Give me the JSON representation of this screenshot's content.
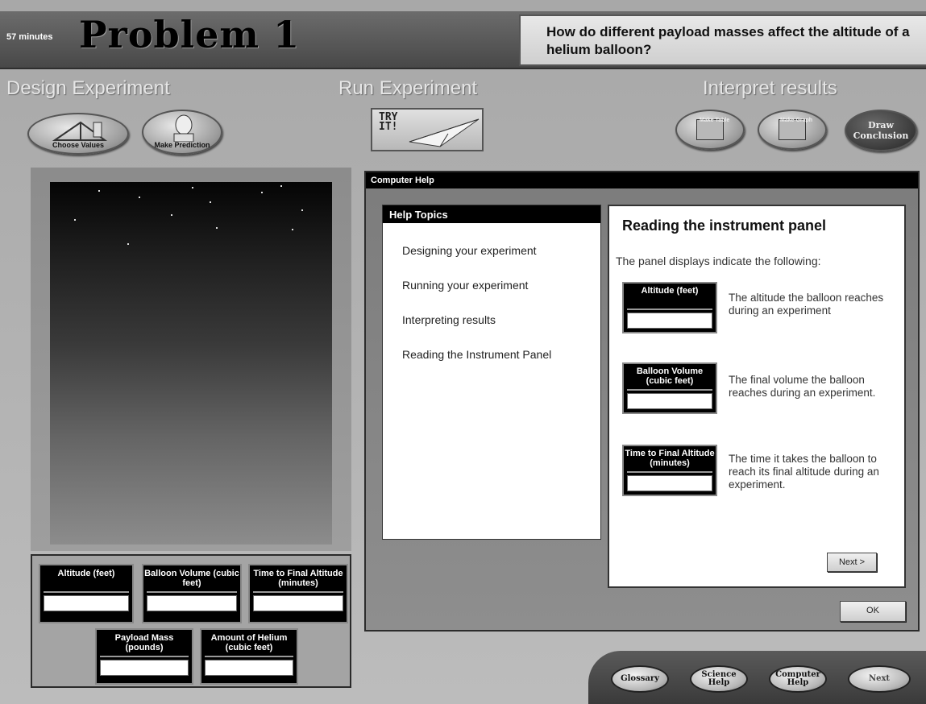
{
  "header": {
    "timer": "57 minutes",
    "problem_title": "Problem 1",
    "question": "How do different payload masses affect the altitude of a helium balloon?"
  },
  "sections": {
    "design": "Design  Experiment",
    "run": "Run  Experiment",
    "interpret": "Interpret results"
  },
  "buttons": {
    "choose_values": "Choose Values",
    "make_prediction": "Make Prediction",
    "try_it": "TRY IT!",
    "make_table": "Make Table",
    "make_graph": "Make Graph",
    "draw_conclusion": "Draw Conclusion"
  },
  "instrument_panel": {
    "altitude": "Altitude (feet)",
    "balloon_volume": "Balloon Volume (cubic feet)",
    "time_to_final": "Time to Final Altitude (minutes)",
    "payload_mass": "Payload Mass (pounds)",
    "amount_helium": "Amount of Helium (cubic feet)"
  },
  "help_window": {
    "title": "Computer Help",
    "topics_header": "Help Topics",
    "topics": [
      "Designing your experiment",
      "Running your experiment",
      "Interpreting results",
      "Reading the Instrument Panel"
    ],
    "content_title": "Reading the instrument panel",
    "content_intro": "The panel displays indicate the following:",
    "items": [
      {
        "gauge": "Altitude (feet)",
        "description": "The altitude the balloon reaches during an experiment"
      },
      {
        "gauge": "Balloon Volume (cubic feet)",
        "description": "The final volume the balloon reaches during an experiment."
      },
      {
        "gauge": "Time to Final Altitude (minutes)",
        "description": "The time it takes the balloon to reach its final altitude during an experiment."
      }
    ],
    "next_label": "Next >",
    "ok_label": "OK"
  },
  "bottom_nav": {
    "glossary": "Glossary",
    "science_help": "Science Help",
    "computer_help": "Computer Help",
    "next": "Next"
  }
}
